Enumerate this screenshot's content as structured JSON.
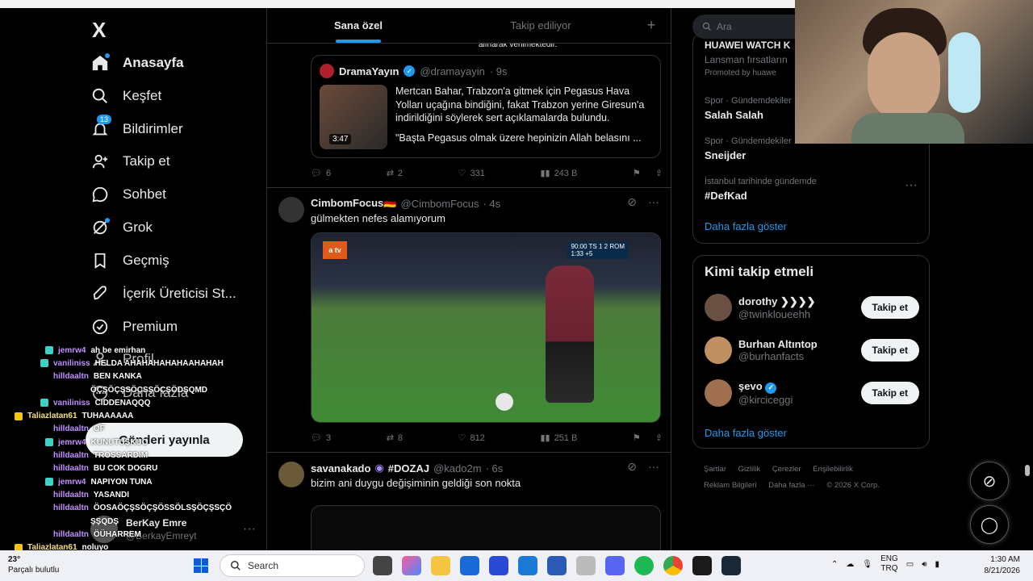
{
  "nav": {
    "logo": "X",
    "items": [
      {
        "label": "Anasayfa",
        "icon": "home-icon"
      },
      {
        "label": "Keşfet",
        "icon": "search-icon"
      },
      {
        "label": "Bildirimler",
        "icon": "bell-icon",
        "badge": "13"
      },
      {
        "label": "Takip et",
        "icon": "add-user-icon"
      },
      {
        "label": "Sohbet",
        "icon": "chat-icon"
      },
      {
        "label": "Grok",
        "icon": "grok-icon"
      },
      {
        "label": "Geçmiş",
        "icon": "bookmark-icon"
      },
      {
        "label": "İçerik Üreticisi St...",
        "icon": "rocket-icon"
      },
      {
        "label": "Premium",
        "icon": "verified-icon"
      },
      {
        "label": "Profil",
        "icon": "profile-icon"
      },
      {
        "label": "Daha fazla",
        "icon": "more-icon"
      }
    ],
    "post_label": "Gönderi yayınla",
    "profile_name": "BerKay Emre",
    "profile_handle": "@BerkayEmreyt"
  },
  "chat": [
    {
      "user": "jemrw4",
      "msg": "ah be emirhan"
    },
    {
      "user": "vaniliniss",
      "msg": "HELDA AHAHAHAHAHAAHAHAH"
    },
    {
      "user": "hilldaaltn",
      "msg": "BEN KANKA"
    },
    {
      "user": "",
      "msg": "ÖÇŞÖÇŞSÖÇSŞÖÇŞÖDŞQMD"
    },
    {
      "user": "vaniliniss",
      "msg": "CIDDENAQQQ"
    },
    {
      "user": "Taliazlatan61",
      "msg": "TUHAAAAAA"
    },
    {
      "user": "hilldaaltn",
      "msg": "OF"
    },
    {
      "user": "jemrw4",
      "msg": "KUNUTUŞKUO"
    },
    {
      "user": "hilldaaltn",
      "msg": "TROSSARDIM"
    },
    {
      "user": "hilldaaltn",
      "msg": "BU COK DOGRU"
    },
    {
      "user": "jemrw4",
      "msg": "NAPIYON TUNA"
    },
    {
      "user": "hilldaaltn",
      "msg": "YASANDI"
    },
    {
      "user": "hilldaaltn",
      "msg": "ÖOSAÖÇŞSÖÇŞÖSSÖLSŞÖÇŞSÇÖ"
    },
    {
      "user": "",
      "msg": "ŞŞQDŞ"
    },
    {
      "user": "hilldaaltn",
      "msg": "ÖÜHARREM"
    },
    {
      "user": "Taliazlatan61",
      "msg": "noluyo"
    }
  ],
  "feed": {
    "tabs": [
      "Sana özel",
      "Takip ediliyor"
    ],
    "tab_plus": "+",
    "quote": {
      "top_snippet": "alınarak verilmektedir.",
      "name": "DramaYayın",
      "handle": "@dramayayin",
      "time": "· 9s",
      "duration": "3:47",
      "text1": "Mertcan Bahar, Trabzon'a gitmek için Pegasus Hava Yolları uçağına bindiğini, fakat Trabzon yerine Giresun'a indirildiğini söylerek sert açıklamalarda bulundu.",
      "text2": "\"Başta Pegasus olmak üzere hepinizin Allah belasını ..."
    },
    "actions1": {
      "replies": "6",
      "reposts": "2",
      "likes": "331",
      "views": "243 B"
    },
    "tweet2": {
      "name": "CimbomFocus🇩🇪",
      "handle": "@CimbomFocus",
      "time": "· 4s",
      "text": "gülmekten nefes alamıyorum",
      "score": "90:00 TS 1 2 ROM",
      "added": "1:33 +5"
    },
    "actions2": {
      "replies": "3",
      "reposts": "8",
      "likes": "812",
      "views": "251 B"
    },
    "tweet3": {
      "name": "savanakado",
      "tag": "#DOZAJ",
      "handle": "@kado2m",
      "time": "· 6s",
      "text": "bizim ani duygu değişiminin geldiği son nokta"
    }
  },
  "right": {
    "search_placeholder": "Ara",
    "promo_title": "HUAWEI WATCH K",
    "promo_sub": "Lansman fırsatların",
    "promoted": "Promoted by huawe",
    "trends": [
      {
        "meta": "Spor · Gündemdekiler",
        "name": "Salah Salah"
      },
      {
        "meta": "Spor · Gündemdekiler",
        "name": "Sneijder"
      },
      {
        "meta": "İstanbul tarihinde gündemde",
        "name": "#DefKad"
      }
    ],
    "trends_more": "Daha fazla göster",
    "who_title": "Kimi takip etmeli",
    "who": [
      {
        "name": "dorothy ❯❯❯❯",
        "handle": "@twinkloueehh",
        "btn": "Takip et"
      },
      {
        "name": "Burhan Altıntop",
        "handle": "@burhanfacts",
        "btn": "Takip et"
      },
      {
        "name": "şevo",
        "handle": "@kirciceggi",
        "btn": "Takip et"
      }
    ],
    "who_more": "Daha fazla göster",
    "footer": [
      "Şartlar",
      "Gizlilik",
      "Çerezler",
      "Erişilebilirlik",
      "Reklam Bilgileri",
      "Daha fazla ···",
      "© 2026 X Corp."
    ]
  },
  "taskbar": {
    "temp": "23°",
    "weather": "Parçalı bulutlu",
    "search": "Search",
    "lang1": "ENG",
    "lang2": "TRQ",
    "time": "1:30 AM",
    "date": "8/21/2026",
    "accent": "#1d9bf0"
  }
}
